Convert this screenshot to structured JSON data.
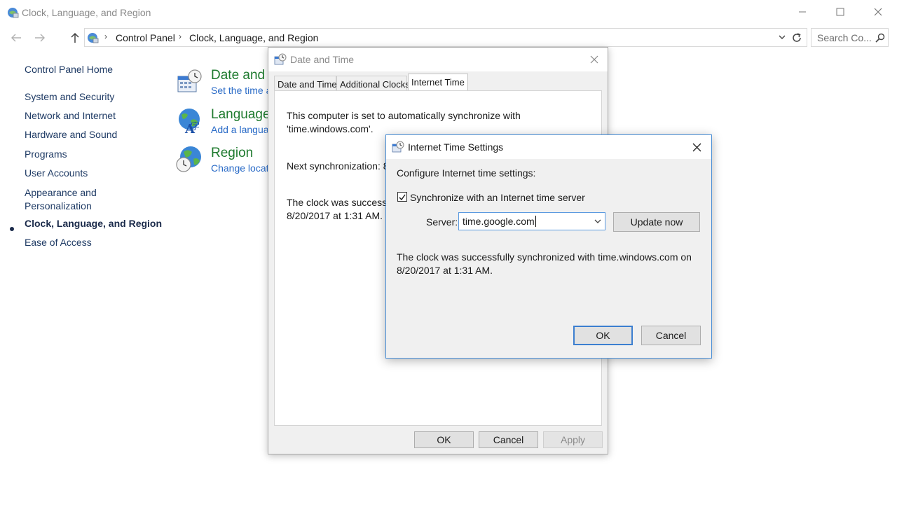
{
  "window": {
    "title": "Clock, Language, and Region",
    "minimize_label": "—",
    "maximize_label": "☐",
    "close_label": "✕"
  },
  "address_bar": {
    "breadcrumbs": [
      "Control Panel",
      "Clock, Language, and Region"
    ],
    "search_placeholder": "Search Co..."
  },
  "sidebar": {
    "home": "Control Panel Home",
    "items": [
      {
        "label": "System and Security"
      },
      {
        "label": "Network and Internet"
      },
      {
        "label": "Hardware and Sound"
      },
      {
        "label": "Programs"
      },
      {
        "label": "User Accounts"
      },
      {
        "label": "Appearance and"
      },
      {
        "label": "Personalization"
      },
      {
        "label": "Clock, Language, and Region",
        "active": true
      },
      {
        "label": "Ease of Access"
      }
    ]
  },
  "categories": [
    {
      "title": "Date and T",
      "subtitle": "Set the time a"
    },
    {
      "title": "Language",
      "subtitle": "Add a langua"
    },
    {
      "title": "Region",
      "subtitle": "Change locati"
    }
  ],
  "date_time_dialog": {
    "title": "Date and Time",
    "tabs": [
      "Date and Time",
      "Additional Clocks",
      "Internet Time"
    ],
    "active_tab": "Internet Time",
    "auto_sync_line1": "This computer is set to automatically synchronize with",
    "auto_sync_line2": "'time.windows.com'.",
    "next_sync": "Next synchronization: 8/",
    "status_line1": "The clock was successfu",
    "status_line2": "8/20/2017 at 1:31 AM.",
    "ok_label": "OK",
    "cancel_label": "Cancel",
    "apply_label": "Apply"
  },
  "internet_time_dialog": {
    "title": "Internet Time Settings",
    "heading": "Configure Internet time settings:",
    "sync_checkbox_label": "Synchronize with an Internet time server",
    "sync_checked": true,
    "server_label": "Server:",
    "server_value": "time.google.com",
    "update_now_label": "Update now",
    "status_line1": "The clock was successfully synchronized with time.windows.com on",
    "status_line2": "8/20/2017 at 1:31 AM.",
    "ok_label": "OK",
    "cancel_label": "Cancel"
  }
}
